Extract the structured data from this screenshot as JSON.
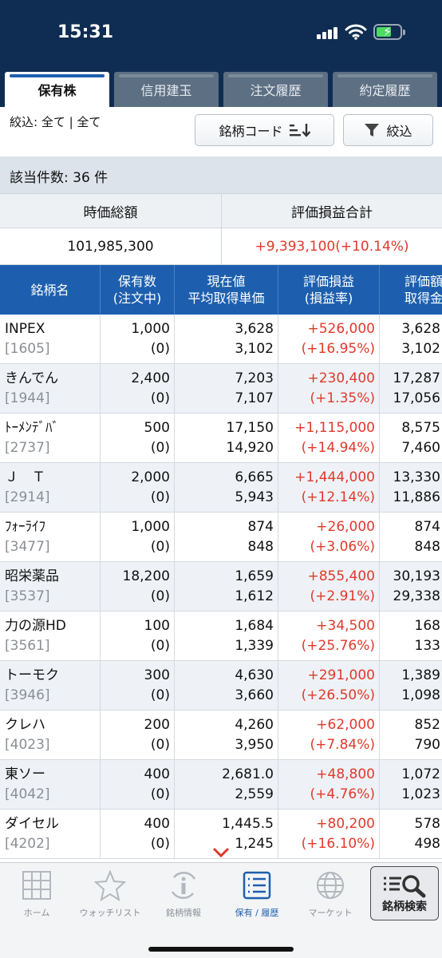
{
  "status_bar": {
    "time": "15:31"
  },
  "tabs": [
    {
      "label": "保有株",
      "active": true
    },
    {
      "label": "信用建玉",
      "active": false
    },
    {
      "label": "注文履歴",
      "active": false
    },
    {
      "label": "約定履歴",
      "active": false
    }
  ],
  "filter": {
    "label": "絞込: 全て | 全て",
    "sort_button": "銘柄コード",
    "filter_button": "絞込"
  },
  "count_text": "該当件数: 36 件",
  "summary": {
    "market_value_label": "時価総額",
    "pl_total_label": "評価損益合計",
    "market_value": "101,985,300",
    "pl_total": "+9,393,100(+10.14%)"
  },
  "table": {
    "headers": [
      [
        "銘柄名"
      ],
      [
        "保有数",
        "(注文中)"
      ],
      [
        "現在値",
        "平均取得単価"
      ],
      [
        "評価損益",
        "(損益率)"
      ],
      [
        "評価額",
        "取得金"
      ]
    ],
    "rows": [
      {
        "name": "INPEX",
        "code": "[1605]",
        "qty": "1,000",
        "ordering": "(0)",
        "price": "3,628",
        "avg": "3,102",
        "pl": "+526,000",
        "rate": "(+16.95%)",
        "value": "3,628",
        "cost": "3,102"
      },
      {
        "name": "きんでん",
        "code": "[1944]",
        "qty": "2,400",
        "ordering": "(0)",
        "price": "7,203",
        "avg": "7,107",
        "pl": "+230,400",
        "rate": "(+1.35%)",
        "value": "17,287",
        "cost": "17,056"
      },
      {
        "name": "ﾄｰﾒﾝﾃﾞﾊﾞ",
        "code": "[2737]",
        "qty": "500",
        "ordering": "(0)",
        "price": "17,150",
        "avg": "14,920",
        "pl": "+1,115,000",
        "rate": "(+14.94%)",
        "value": "8,575",
        "cost": "7,460"
      },
      {
        "name": "Ｊ　Ｔ",
        "code": "[2914]",
        "qty": "2,000",
        "ordering": "(0)",
        "price": "6,665",
        "avg": "5,943",
        "pl": "+1,444,000",
        "rate": "(+12.14%)",
        "value": "13,330",
        "cost": "11,886"
      },
      {
        "name": "ﾌｫｰﾗｲﾌ",
        "code": "[3477]",
        "qty": "1,000",
        "ordering": "(0)",
        "price": "874",
        "avg": "848",
        "pl": "+26,000",
        "rate": "(+3.06%)",
        "value": "874",
        "cost": "848"
      },
      {
        "name": "昭栄薬品",
        "code": "[3537]",
        "qty": "18,200",
        "ordering": "(0)",
        "price": "1,659",
        "avg": "1,612",
        "pl": "+855,400",
        "rate": "(+2.91%)",
        "value": "30,193",
        "cost": "29,338"
      },
      {
        "name": "力の源HD",
        "code": "[3561]",
        "qty": "100",
        "ordering": "(0)",
        "price": "1,684",
        "avg": "1,339",
        "pl": "+34,500",
        "rate": "(+25.76%)",
        "value": "168",
        "cost": "133"
      },
      {
        "name": "トーモク",
        "code": "[3946]",
        "qty": "300",
        "ordering": "(0)",
        "price": "4,630",
        "avg": "3,660",
        "pl": "+291,000",
        "rate": "(+26.50%)",
        "value": "1,389",
        "cost": "1,098"
      },
      {
        "name": "クレハ",
        "code": "[4023]",
        "qty": "200",
        "ordering": "(0)",
        "price": "4,260",
        "avg": "3,950",
        "pl": "+62,000",
        "rate": "(+7.84%)",
        "value": "852",
        "cost": "790"
      },
      {
        "name": "東ソー",
        "code": "[4042]",
        "qty": "400",
        "ordering": "(0)",
        "price": "2,681.0",
        "avg": "2,559",
        "pl": "+48,800",
        "rate": "(+4.76%)",
        "value": "1,072",
        "cost": "1,023"
      },
      {
        "name": "ダイセル",
        "code": "[4202]",
        "qty": "400",
        "ordering": "(0)",
        "price": "1,445.5",
        "avg": "1,245",
        "pl": "+80,200",
        "rate": "(+16.10%)",
        "value": "578",
        "cost": "498"
      }
    ]
  },
  "nav": [
    {
      "label": "ホーム",
      "icon": "grid-icon",
      "active": false
    },
    {
      "label": "ウォッチリスト",
      "icon": "star-icon",
      "active": false
    },
    {
      "label": "銘柄情報",
      "icon": "info-icon",
      "active": false
    },
    {
      "label": "保有 / 履歴",
      "icon": "list-icon",
      "active": true
    },
    {
      "label": "マーケット",
      "icon": "globe-icon",
      "active": false
    }
  ],
  "nav_search_label": "銘柄検索",
  "colors": {
    "header_navy": "#0f2d52",
    "table_blue": "#1d5fae",
    "gain_red": "#e0392b"
  }
}
